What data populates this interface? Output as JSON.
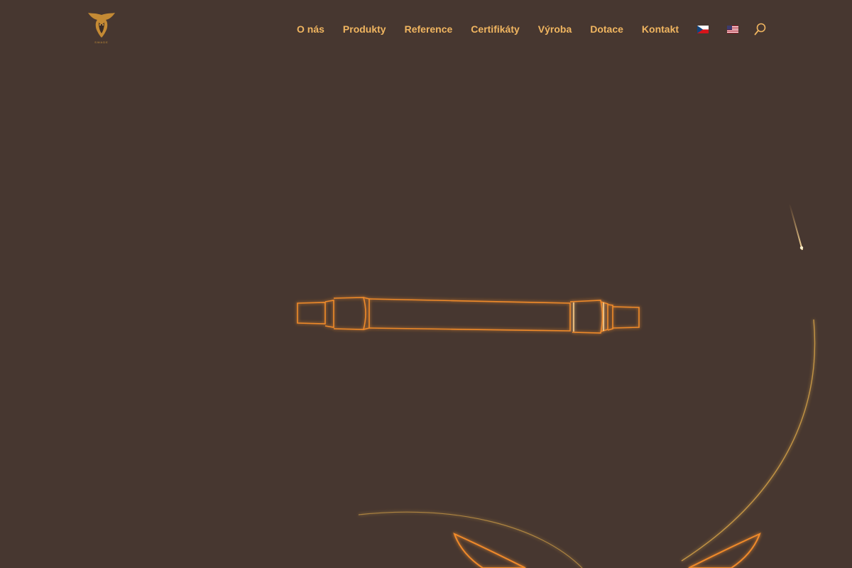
{
  "header": {
    "logo": {
      "icon": "winged-lion-emblem-icon",
      "text": "SWADE"
    },
    "nav": [
      {
        "label": "O nás"
      },
      {
        "label": "Produkty"
      },
      {
        "label": "Reference"
      },
      {
        "label": "Certifikáty"
      },
      {
        "label": "Výroba"
      },
      {
        "label": "Dotace"
      },
      {
        "label": "Kontakt"
      }
    ],
    "languages": [
      {
        "icon": "czech-flag-icon"
      },
      {
        "icon": "us-flag-icon"
      }
    ],
    "search": {
      "icon": "search-icon"
    }
  },
  "hero": {
    "illustration": "glowing-shaft-outline",
    "colors": {
      "background": "#473730",
      "accent": "#f0b560",
      "glow": "#e88a2c"
    }
  }
}
